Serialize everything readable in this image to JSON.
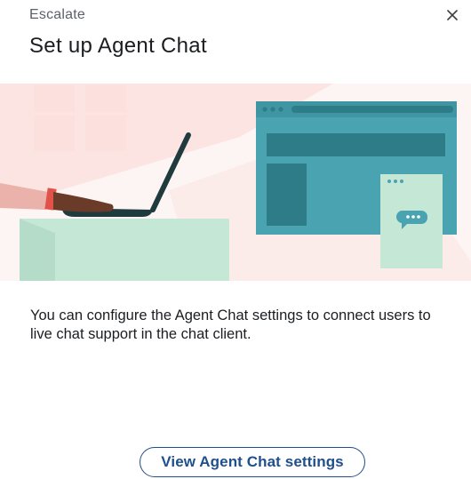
{
  "header": {
    "eyebrow": "Escalate",
    "title": "Set up Agent Chat",
    "close_icon": "close-icon",
    "close_glyph": "×"
  },
  "illustration": {
    "description_icon": "agent-chat-illustration",
    "colors": {
      "background": "#fbeceb",
      "window": "#4aa3b0",
      "window_dark": "#2e7c88",
      "bubble_card": "#c5e7d6",
      "desk": "#c5e7d6",
      "laptop": "#1f3b3e",
      "skin": "#6b3b2a",
      "sleeve": "#eab2aa"
    }
  },
  "body": {
    "description": "You can configure the Agent Chat settings to connect users to live chat support in the chat client."
  },
  "actions": {
    "view_settings_label": "View Agent Chat settings"
  },
  "theme": {
    "accent": "#1f4f8c"
  }
}
